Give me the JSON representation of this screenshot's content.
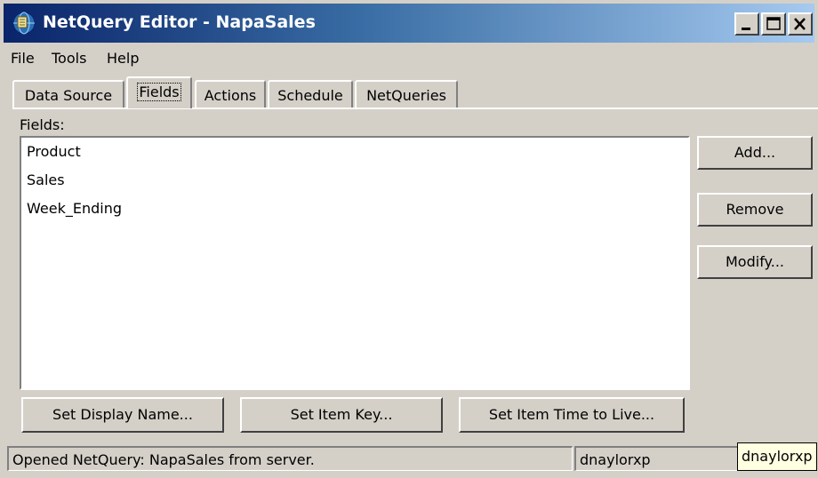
{
  "window": {
    "title": "NetQuery Editor - NapaSales",
    "icon": "netquery-app-icon",
    "minimize_icon": "minimize-icon",
    "maximize_icon": "maximize-icon",
    "close_icon": "close-icon"
  },
  "menu": {
    "items": [
      {
        "label": "File"
      },
      {
        "label": "Tools"
      },
      {
        "label": "Help"
      }
    ]
  },
  "tabs": [
    {
      "label": "Data Source",
      "active": false
    },
    {
      "label": "Fields",
      "active": true
    },
    {
      "label": "Actions",
      "active": false
    },
    {
      "label": "Schedule",
      "active": false
    },
    {
      "label": "NetQueries",
      "active": false
    }
  ],
  "fields": {
    "label": "Fields:",
    "items": [
      "Product",
      "Sales",
      "Week_Ending"
    ]
  },
  "side_buttons": {
    "add": "Add...",
    "remove": "Remove",
    "modify": "Modify..."
  },
  "bottom_buttons": {
    "set_display_name": "Set Display Name...",
    "set_item_key": "Set Item Key...",
    "set_item_ttl": "Set Item Time to Live..."
  },
  "status": {
    "message": "Opened NetQuery: NapaSales from server.",
    "user": "dnaylorxp"
  },
  "tooltip": {
    "text": "dnaylorxp"
  },
  "colors": {
    "face": "#d4d0c8",
    "title_start": "#0a246a",
    "title_end": "#a6caf0",
    "tooltip_bg": "#ffffe1"
  }
}
